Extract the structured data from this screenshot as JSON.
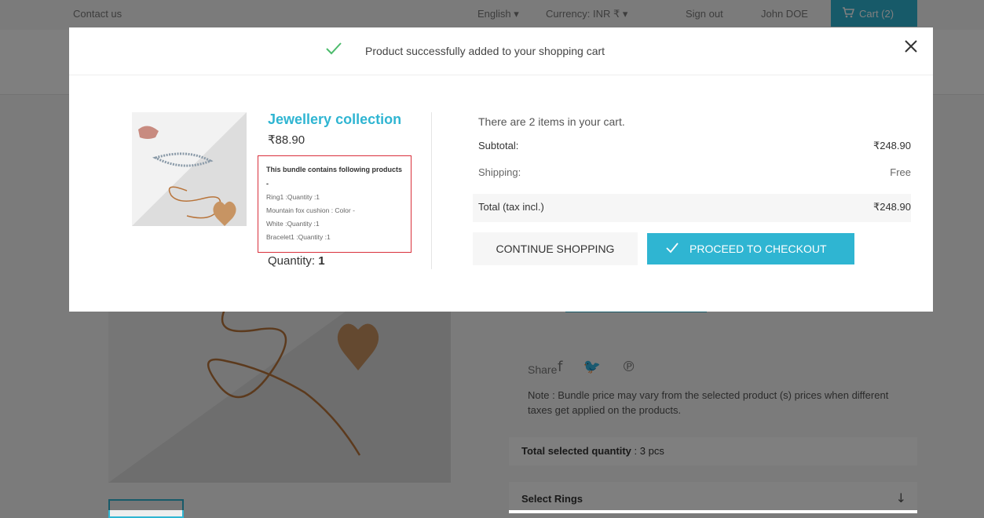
{
  "topbar": {
    "contact": "Contact us",
    "language": "English ▾",
    "currency": "Currency: INR ₹ ▾",
    "signout": "Sign out",
    "user": "John DOE",
    "cart": "Cart (2)"
  },
  "page": {
    "share_label": "Share",
    "note": "Note : Bundle price may vary from the selected product (s) prices when different taxes get applied on the products.",
    "total_selected_label": "Total selected quantity",
    "total_selected_value": ": 3 pcs",
    "select_rings": "Select Rings"
  },
  "modal": {
    "title": "Product successfully added to your shopping cart",
    "product_name": "Jewellery collection",
    "product_price": "₹88.90",
    "bundle_title": "This bundle contains following products -",
    "bundle_lines": [
      "Ring1 :Quantity :1",
      "Mountain fox cushion : Color -",
      "White :Quantity :1",
      "Bracelet1 :Quantity :1"
    ],
    "quantity_label": "Quantity:",
    "quantity_value": "1",
    "cart_count_text": "There are 2 items in your cart.",
    "subtotal_label": "Subtotal:",
    "subtotal_value": "₹248.90",
    "shipping_label": "Shipping:",
    "shipping_value": "Free",
    "total_label": "Total (tax incl.)",
    "total_value": "₹248.90",
    "continue_label": "CONTINUE SHOPPING",
    "checkout_label": "PROCEED TO CHECKOUT"
  },
  "colors": {
    "accent": "#2fb5d2",
    "success": "#4cbb6c",
    "highlight_border": "#d9303c"
  }
}
